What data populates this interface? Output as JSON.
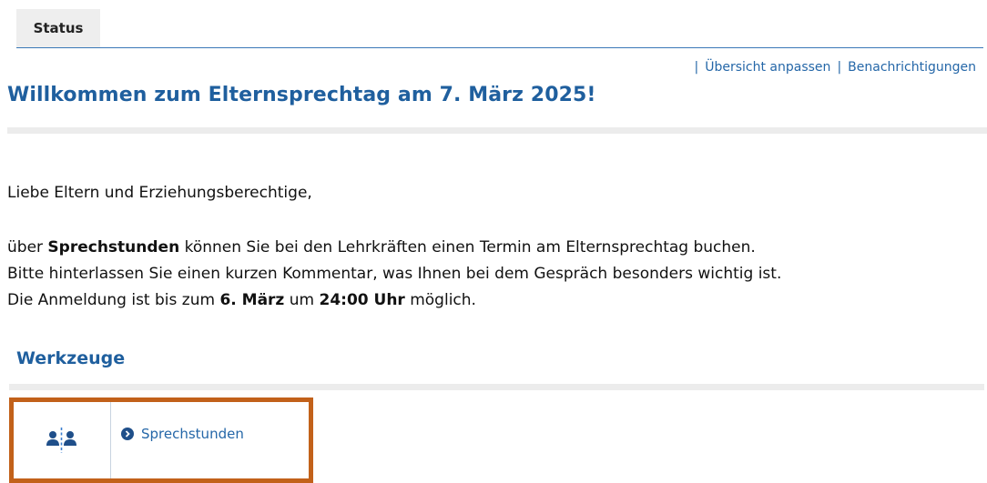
{
  "tabs": [
    {
      "label": "Status"
    }
  ],
  "top_links": {
    "separator": "|",
    "adjust_overview": "Übersicht anpassen",
    "notifications": "Benachrichtigungen"
  },
  "page": {
    "title": "Willkommen zum Elternsprechtag am 7. März 2025!"
  },
  "intro": {
    "greeting": "Liebe Eltern und Erziehungsberechtige,",
    "line1_prefix": "über ",
    "line1_bold": "Sprechstunden",
    "line1_suffix": " können Sie bei den Lehrkräften einen Termin am Elternsprechtag buchen.",
    "line2": "Bitte hinterlassen Sie einen kurzen Kommentar, was Ihnen bei dem Gespräch besonders wichtig ist.",
    "line3_prefix": "Die Anmeldung ist bis zum ",
    "line3_bold1": "6. März",
    "line3_mid": " um ",
    "line3_bold2": "24:00 Uhr",
    "line3_suffix": " möglich."
  },
  "tools": {
    "heading": "Werkzeuge",
    "items": [
      {
        "label": "Sprechstunden",
        "icon": "consultation-icon"
      }
    ]
  },
  "colors": {
    "accent": "#1f5f9e",
    "link": "#2567a8",
    "highlight_border": "#c2611a"
  }
}
